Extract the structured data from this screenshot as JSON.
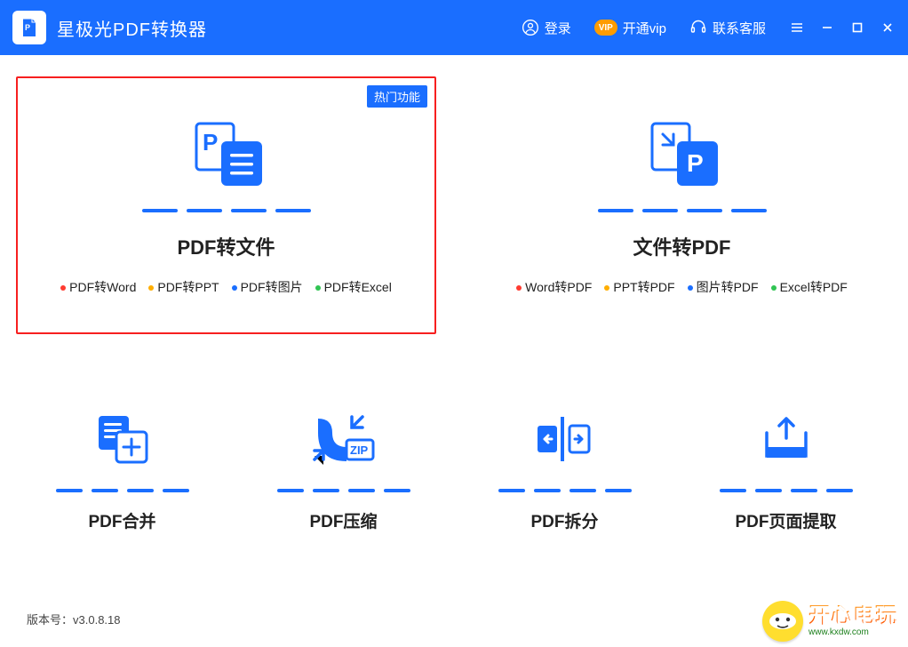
{
  "titlebar": {
    "app_title": "星极光PDF转换器",
    "login_label": "登录",
    "vip_label": "开通vip",
    "support_label": "联系客服"
  },
  "hot_badge": "热门功能",
  "big_cards": [
    {
      "title": "PDF转文件",
      "subs": [
        "PDF转Word",
        "PDF转PPT",
        "PDF转图片",
        "PDF转Excel"
      ]
    },
    {
      "title": "文件转PDF",
      "subs": [
        "Word转PDF",
        "PPT转PDF",
        "图片转PDF",
        "Excel转PDF"
      ]
    }
  ],
  "small_cards": [
    {
      "title": "PDF合并"
    },
    {
      "title": "PDF压缩"
    },
    {
      "title": "PDF拆分"
    },
    {
      "title": "PDF页面提取"
    }
  ],
  "sub_colors": [
    "#ff3b30",
    "#ffae00",
    "#1a6eff",
    "#30c453"
  ],
  "footer_prefix": "版本号：",
  "footer_version": "v3.0.8.18",
  "watermark": {
    "cn": "开心电玩",
    "url": "www.kxdw.com"
  },
  "colors": {
    "primary": "#1a6eff"
  }
}
